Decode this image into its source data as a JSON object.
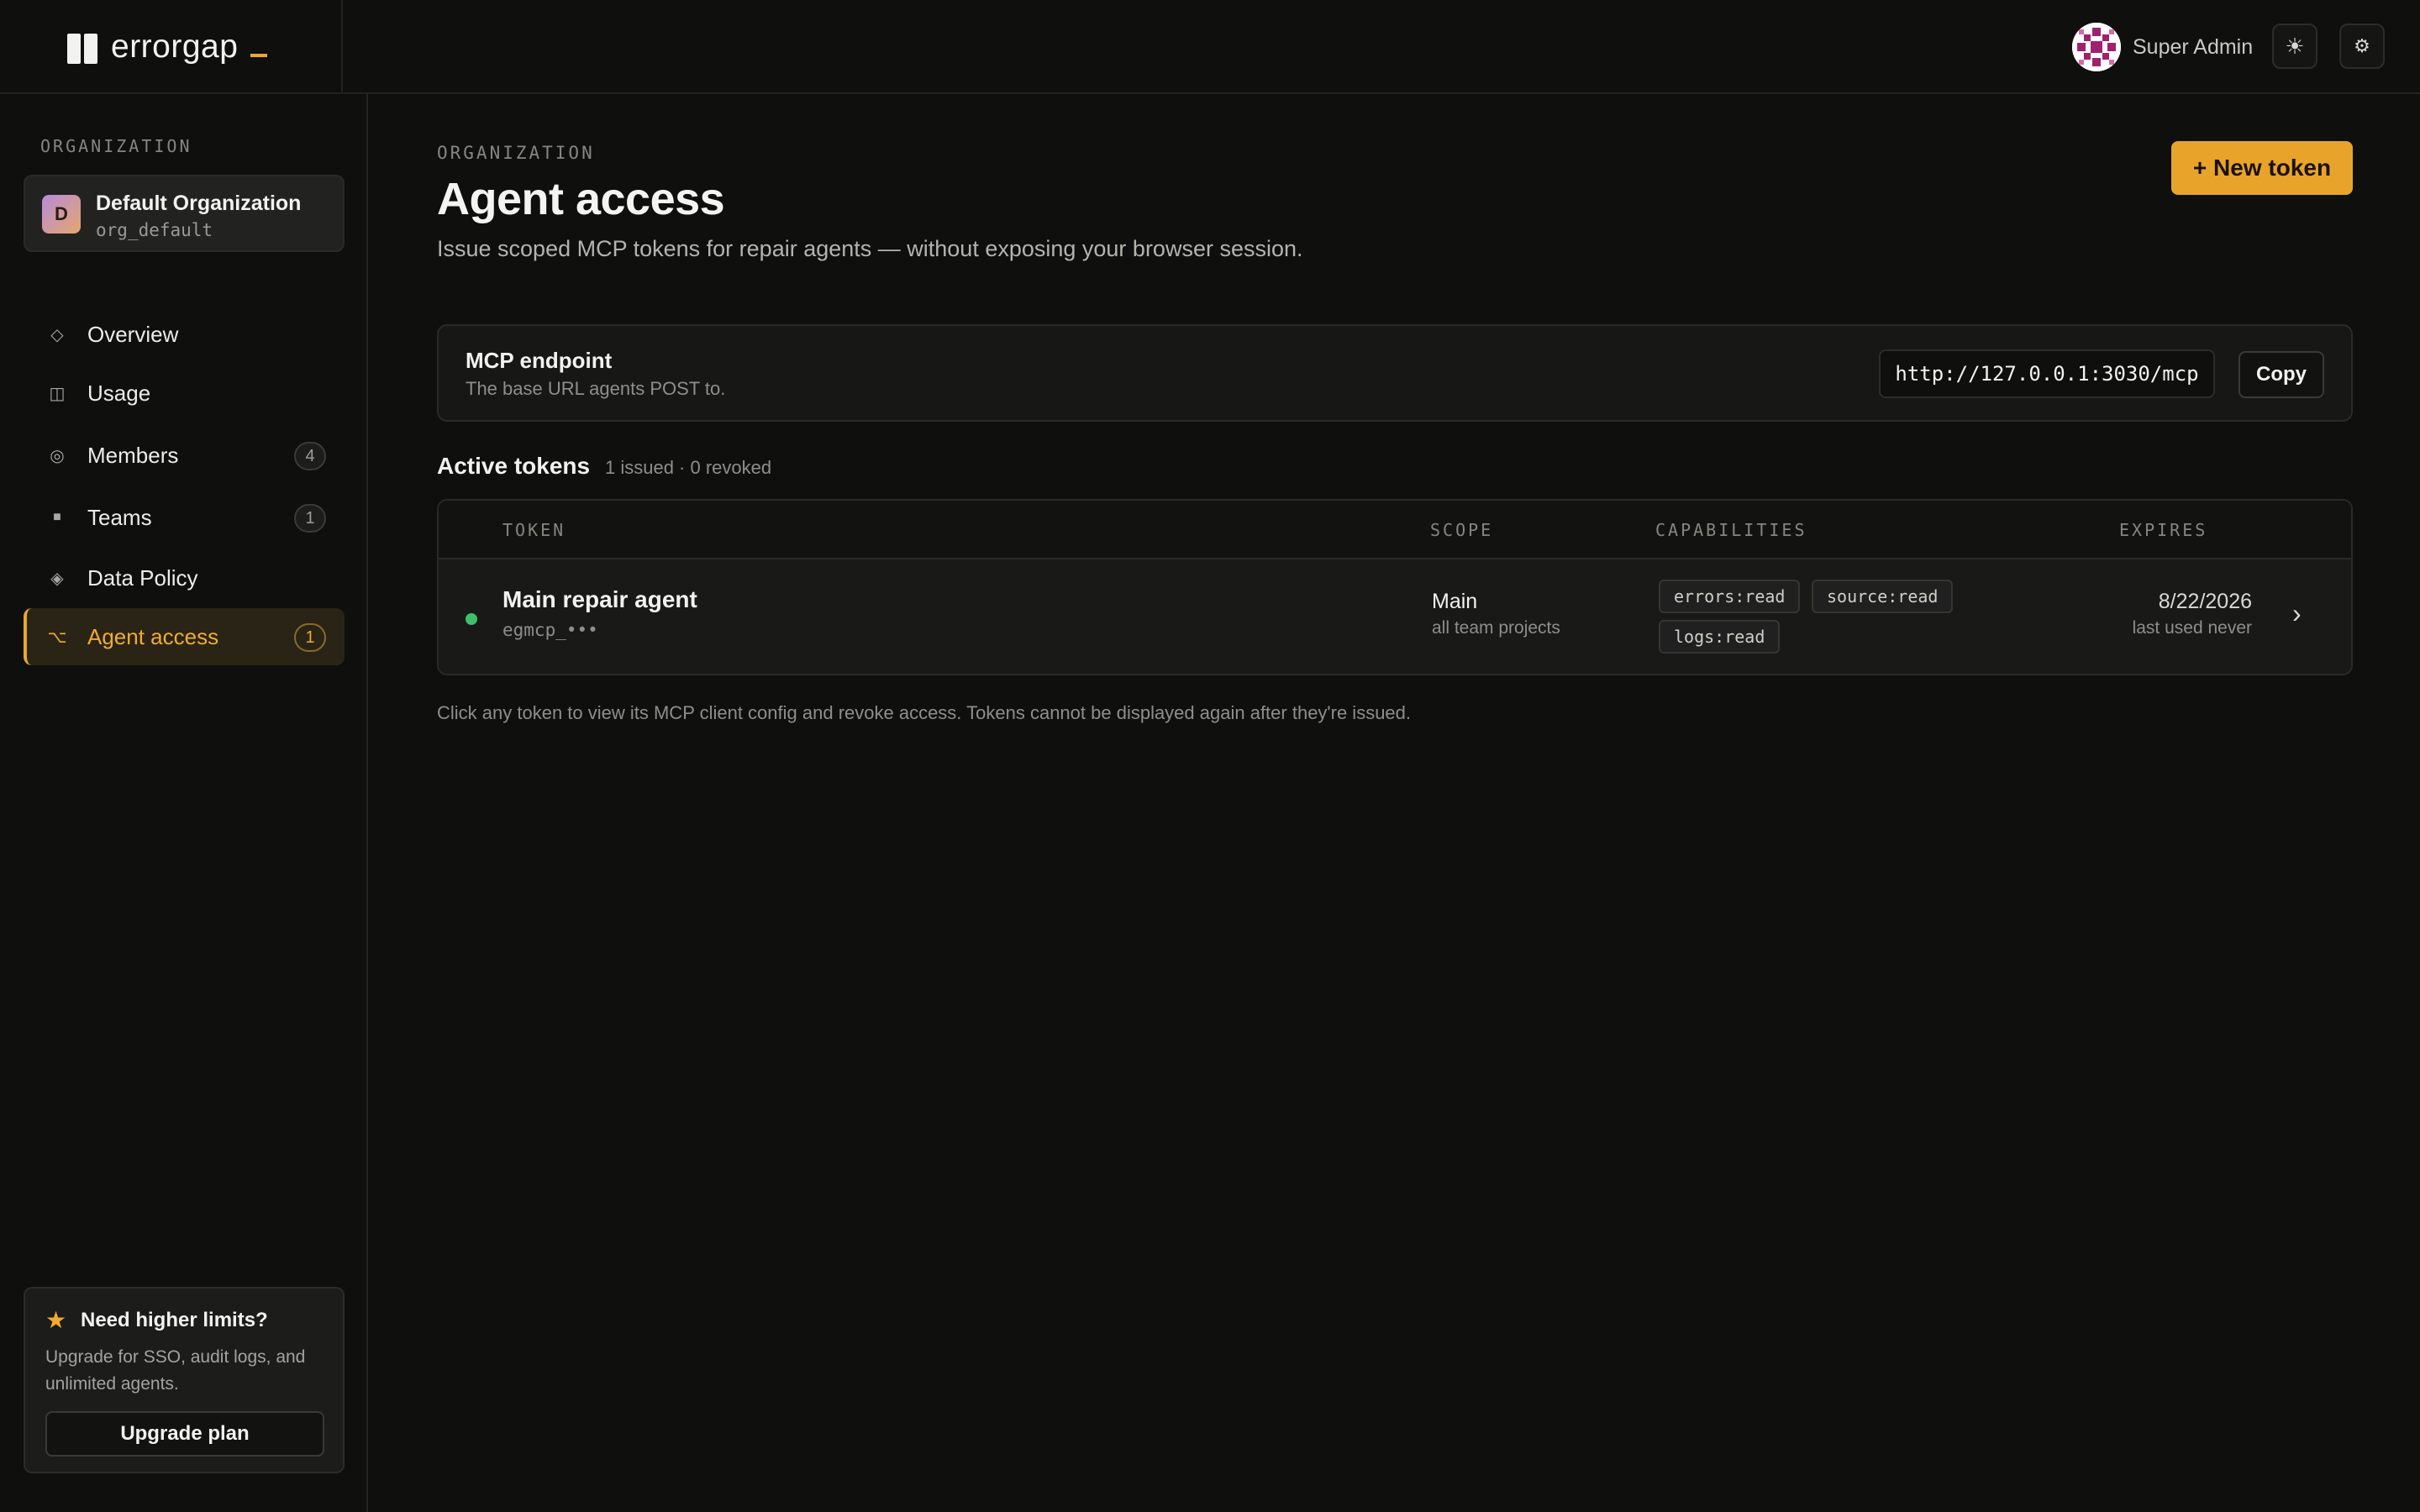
{
  "brand": {
    "name": "errorgap"
  },
  "header": {
    "user_name": "Super Admin",
    "theme_icon": "sun-icon",
    "settings_icon": "gear-icon"
  },
  "sidebar": {
    "section_label": "ORGANIZATION",
    "org": {
      "initial": "D",
      "name": "Default Organization",
      "id": "org_default"
    },
    "items": [
      {
        "label": "Overview",
        "icon": "diamond-outline-icon",
        "glyph": "◇"
      },
      {
        "label": "Usage",
        "icon": "columns-icon",
        "glyph": "◫"
      },
      {
        "label": "Members",
        "icon": "circle-ring-icon",
        "glyph": "◎",
        "count": "4"
      },
      {
        "label": "Teams",
        "icon": "square-icon",
        "glyph": "■",
        "count": "1"
      },
      {
        "label": "Data Policy",
        "icon": "diamond-dot-icon",
        "glyph": "◈"
      },
      {
        "label": "Agent access",
        "icon": "option-key-icon",
        "glyph": "⌥",
        "count": "1",
        "active": true
      }
    ],
    "upgrade": {
      "title": "Need higher limits?",
      "text": "Upgrade for SSO, audit logs, and unlimited agents.",
      "button": "Upgrade plan"
    }
  },
  "main": {
    "eyebrow": "ORGANIZATION",
    "title": "Agent access",
    "description": "Issue scoped MCP tokens for repair agents — without exposing your browser session.",
    "new_token_button": "+ New token",
    "endpoint": {
      "title": "MCP endpoint",
      "subtitle": "The base URL agents POST to.",
      "url": "http://127.0.0.1:3030/mcp",
      "copy_button": "Copy"
    },
    "tokens": {
      "heading": "Active tokens",
      "meta": "1 issued · 0 revoked",
      "columns": [
        "TOKEN",
        "SCOPE",
        "CAPABILITIES",
        "EXPIRES"
      ],
      "rows": [
        {
          "name": "Main repair agent",
          "prefix": "egmcp_•••",
          "status_color": "#3fbf6a",
          "scope": "Main",
          "scope_detail": "all team projects",
          "capabilities": [
            "errors:read",
            "source:read",
            "logs:read"
          ],
          "expires": "8/22/2026",
          "last_used": "last used never"
        }
      ]
    },
    "footnote": "Click any token to view its MCP client config and revoke access. Tokens cannot be displayed again after they're issued."
  },
  "colors": {
    "accent": "#e8a42a",
    "status_active": "#3fbf6a",
    "background": "#0f0f0e"
  }
}
